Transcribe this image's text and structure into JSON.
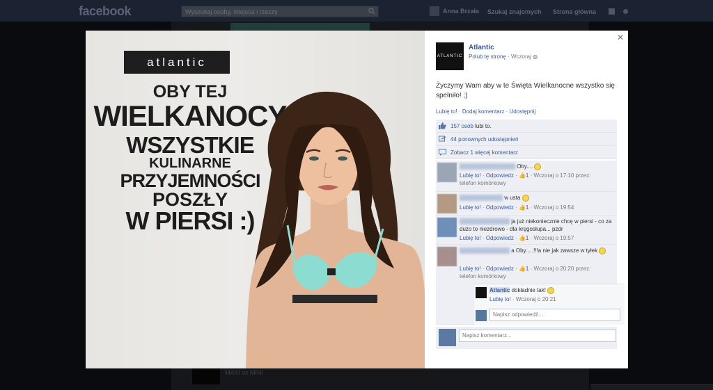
{
  "topbar": {
    "logo": "facebook",
    "search_placeholder": "Wyszukaj osoby, miejsca i rzeczy",
    "user_name": "Anna Brzała",
    "links": [
      "Szukaj znajomych",
      "Strona główna"
    ]
  },
  "background": {
    "caption": "MAXI vs MINI"
  },
  "photo": {
    "brand": "atlantic",
    "lines": [
      "OBY TEJ",
      "WIELKANOCY",
      "WSZYSTKIE",
      "KULINARNE",
      "PRZYJEMNOŚCI",
      "POSZŁY",
      "W PIERSI :)"
    ]
  },
  "post": {
    "page_name": "Atlantic",
    "avatar_text": "ATLANTIC",
    "like_page": "Polub tę stronę",
    "time": "Wczoraj",
    "text": "Życzymy Wam aby w te Święta Wielkanocne wszystko się spełniło! ;)",
    "actions": {
      "like": "Lubię to!",
      "comment": "Dodaj komentarz",
      "share": "Udostępnij"
    },
    "likes_count": "157 osób",
    "likes_suffix": "lubi to.",
    "shares": "44 ponownych udostępnień",
    "more_comments": "Zobacz 1 więcej komentarz"
  },
  "comments": [
    {
      "text": "Oby....",
      "like": "Lubię to!",
      "reply": "Odpowiedz",
      "likes": "1",
      "time": "Wczoraj o 17:10 przez:",
      "device": "telefon komórkowy"
    },
    {
      "text": "w usta",
      "like": "Lubię to!",
      "reply": "Odpowiedz",
      "likes": "1",
      "time": "Wczoraj o 19:54"
    },
    {
      "text": "ja już niekoniecznie chcę w piersi - co za dużo to niezdrowo - dla kręgosłupa... pzdr",
      "like": "Lubię to!",
      "reply": "Odpowiedz",
      "likes": "1",
      "time": "Wczoraj o 19:57"
    },
    {
      "text": "a Oby.....!!!a nie jak zawsze w tyłek",
      "like": "Lubię to!",
      "reply": "Odpowiedz",
      "likes": "1",
      "time": "Wczoraj o 20:20 przez:",
      "device": "telefon komórkowy"
    }
  ],
  "reply": {
    "author": "Atlantic",
    "text": "dokładnie tak!",
    "like": "Lubię to!",
    "time": "Wczoraj o 20:21",
    "input_placeholder": "Napisz odpowiedź..."
  },
  "new_comment": {
    "placeholder": "Napisz komentarz..."
  },
  "colors": {
    "link": "#3b5998",
    "ufi_bg": "#edeff4",
    "dim_bg": "#0a0b0e"
  }
}
